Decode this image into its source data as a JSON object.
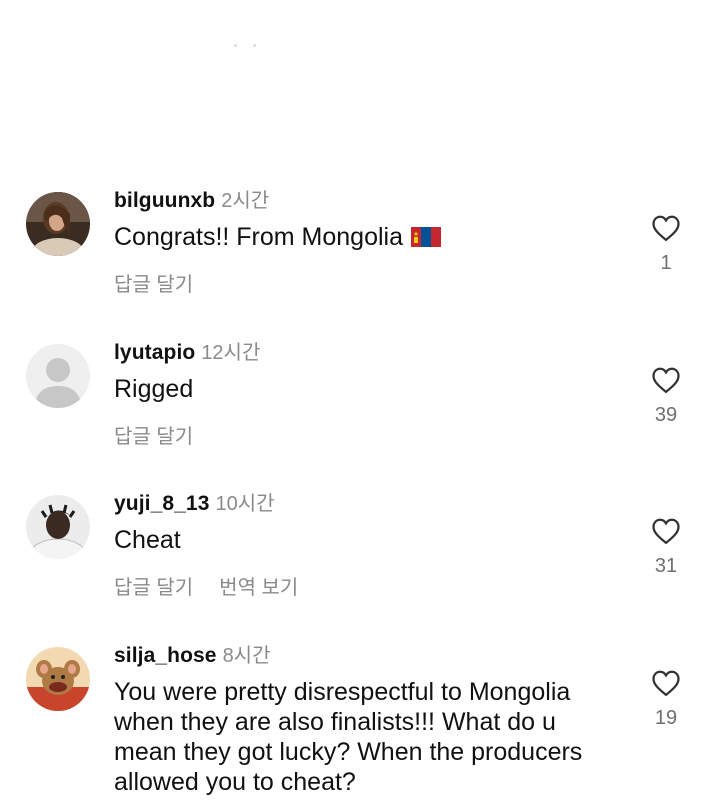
{
  "comments": [
    {
      "username": "bilguunxb",
      "time": "2시간",
      "text": "Congrats!! From Mongolia",
      "has_flag": true,
      "flag_icon": "mongolia-flag",
      "reply_label": "답글 달기",
      "translate_label": "",
      "likes": "1"
    },
    {
      "username": "lyutapio",
      "time": "12시간",
      "text": "Rigged",
      "reply_label": "답글 달기",
      "translate_label": "",
      "likes": "39"
    },
    {
      "username": "yuji_8_13",
      "time": "10시간",
      "text": "Cheat",
      "reply_label": "답글 달기",
      "translate_label": "번역 보기",
      "likes": "31"
    },
    {
      "username": "silja_hose",
      "time": "8시간",
      "text": "You were pretty disrespectful to Mongolia when they are also finalists!!! What do u mean they got lucky? When the producers allowed you to cheat?",
      "reply_label": "",
      "translate_label": "",
      "likes": "19"
    }
  ],
  "icons": {
    "like": "heart-outline-icon"
  },
  "colors": {
    "secondary_text": "#8a8a8a",
    "primary_text": "#111111"
  }
}
